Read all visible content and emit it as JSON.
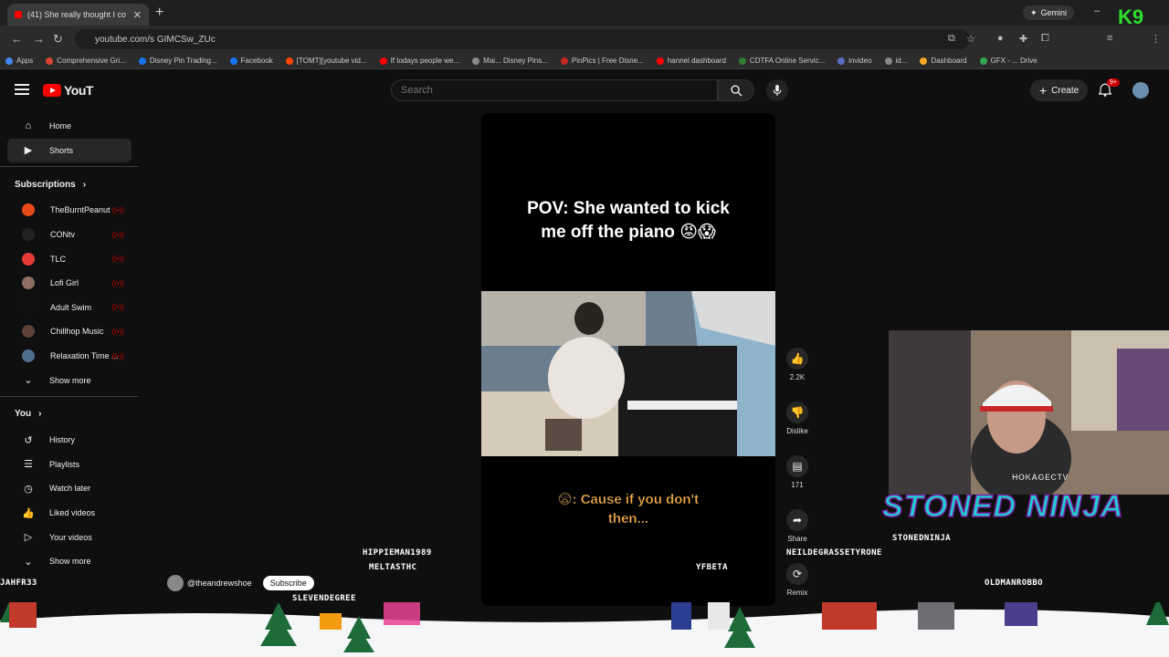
{
  "browser": {
    "tab_title": "(41) She really thought I co",
    "new_tab": "+",
    "gemini_label": "Gemini",
    "url": "youtube.com/s GIMCSw_ZUc",
    "bookmarks": [
      {
        "label": "Apps",
        "color": "#4285f4"
      },
      {
        "label": "Comprehensive Gri...",
        "color": "#db4437"
      },
      {
        "label": "Disney Pin Trading...",
        "color": "#1a73e8"
      },
      {
        "label": "Facebook",
        "color": "#1877f2"
      },
      {
        "label": "[TOMT][youtube vid...",
        "color": "#ff4500"
      },
      {
        "label": "If todays people we...",
        "color": "#ff0000"
      },
      {
        "label": "Mai... Disney Pins...",
        "color": "#888888"
      },
      {
        "label": "PinPics | Free Disne...",
        "color": "#c62828"
      },
      {
        "label": "hannel dashboard",
        "color": "#ff0000"
      },
      {
        "label": "CDTFA Online Servic...",
        "color": "#2e7d32"
      },
      {
        "label": "invideo",
        "color": "#5c6bc0"
      },
      {
        "label": "id...",
        "color": "#888888"
      },
      {
        "label": "Dashboard",
        "color": "#f9a825"
      },
      {
        "label": "GFX - ... Drive",
        "color": "#34a853"
      }
    ],
    "overlay_number": "9"
  },
  "header": {
    "logo_text": "YouT",
    "search_placeholder": "Search",
    "create_label": "Create",
    "notification_badge": "9+"
  },
  "sidebar": {
    "main": [
      {
        "label": "Home",
        "icon": "home-icon"
      },
      {
        "label": "Shorts",
        "icon": "shorts-icon",
        "active": true
      }
    ],
    "subscriptions_title": "Subscriptions",
    "subscriptions": [
      {
        "label": "TheBurntPeanut",
        "color": "#e64a19"
      },
      {
        "label": "CONtv",
        "color": "#222222"
      },
      {
        "label": "TLC",
        "color": "#e53935"
      },
      {
        "label": "Lofi Girl",
        "color": "#8d6e63"
      },
      {
        "label": "Adult Swim",
        "color": "#111111"
      },
      {
        "label": "Chillhop Music",
        "color": "#5d4037"
      },
      {
        "label": "Relaxation Time ...",
        "color": "#4e6e8e"
      }
    ],
    "show_more_1": "Show more",
    "you_title": "You",
    "you": [
      {
        "label": "History",
        "icon": "history-icon"
      },
      {
        "label": "Playlists",
        "icon": "playlists-icon"
      },
      {
        "label": "Watch later",
        "icon": "watch-later-icon"
      },
      {
        "label": "Liked videos",
        "icon": "liked-videos-icon"
      },
      {
        "label": "Your videos",
        "icon": "your-videos-icon"
      }
    ],
    "show_more_2": "Show more"
  },
  "short": {
    "caption_line1": "POV: She wanted to kick",
    "caption_line2": "me off the piano 😡😱",
    "subtitle_line1": "😨: Cause if you don't",
    "subtitle_line2": "then...",
    "channel": "@theandrewshoe",
    "subscribe": "Subscribe"
  },
  "actions": {
    "likes": "2.2K",
    "dislike": "Dislike",
    "comments": "171",
    "share": "Share",
    "remix": "Remix"
  },
  "stream_overlay": {
    "cam_handle": "HOKAGECTV",
    "brand": "STONED NINJA",
    "users": [
      {
        "name": "HIPPIEMAN1989"
      },
      {
        "name": "MELTASTHC"
      },
      {
        "name": "SLEVENDEGREE"
      },
      {
        "name": "YFBETA"
      },
      {
        "name": "STONEDNINJA"
      },
      {
        "name": "NEILDEGRASSETYRONE"
      },
      {
        "name": "OLDMANROBBO"
      },
      {
        "name": "JAHFR33"
      }
    ]
  },
  "colors": {
    "accent_red": "#ff0000",
    "brand_text": "#1fcfcf",
    "brand_stroke": "#7b1fa2"
  }
}
